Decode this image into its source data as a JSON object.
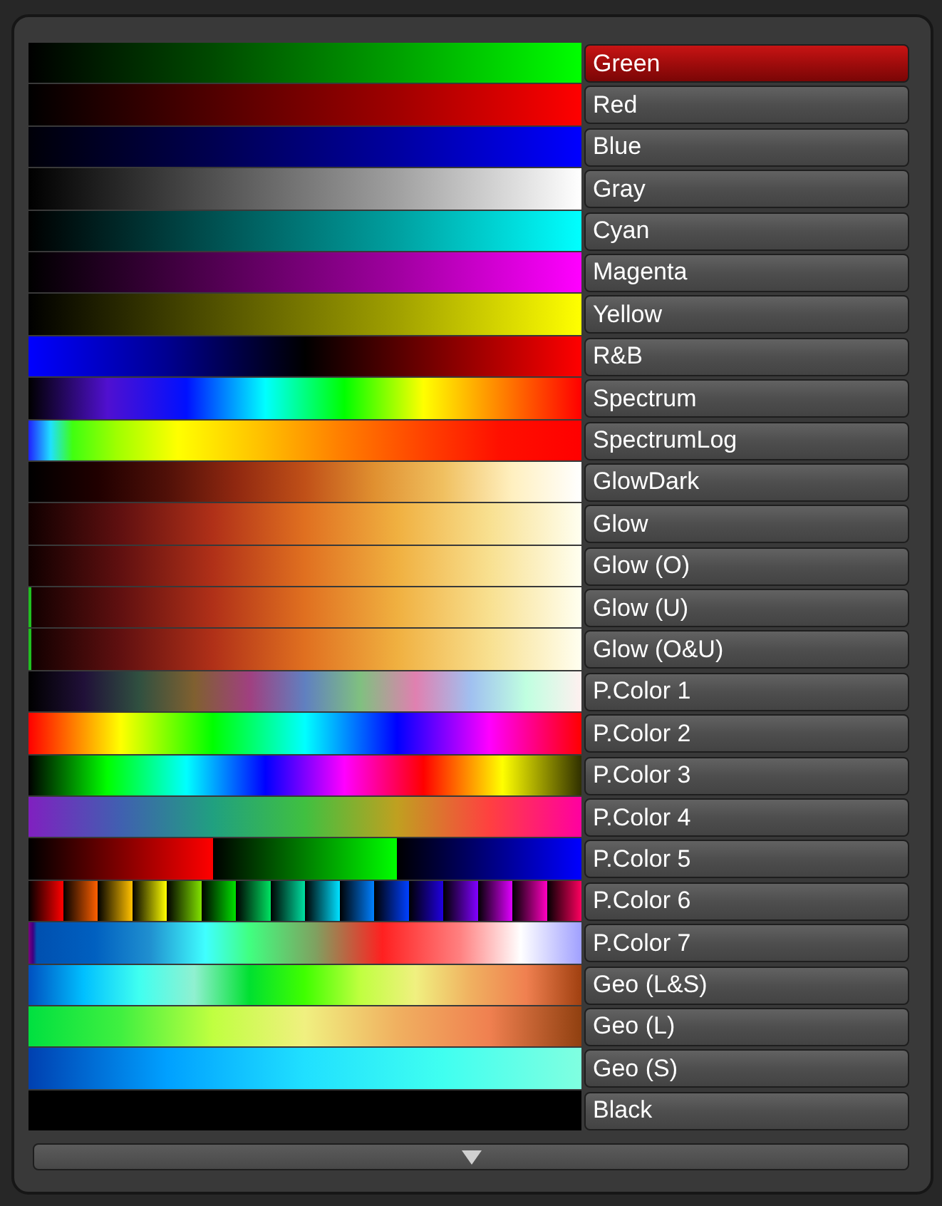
{
  "colormap_menu": {
    "items": [
      {
        "label": "Green",
        "selected": true,
        "kind": "green",
        "underflow": false
      },
      {
        "label": "Red",
        "selected": false,
        "kind": "red",
        "underflow": false
      },
      {
        "label": "Blue",
        "selected": false,
        "kind": "blue",
        "underflow": false
      },
      {
        "label": "Gray",
        "selected": false,
        "kind": "gray",
        "underflow": false
      },
      {
        "label": "Cyan",
        "selected": false,
        "kind": "cyan",
        "underflow": false
      },
      {
        "label": "Magenta",
        "selected": false,
        "kind": "magenta",
        "underflow": false
      },
      {
        "label": "Yellow",
        "selected": false,
        "kind": "yellow",
        "underflow": false
      },
      {
        "label": "R&B",
        "selected": false,
        "kind": "bluered",
        "underflow": false
      },
      {
        "label": "Spectrum",
        "selected": false,
        "kind": "spectrum",
        "underflow": false
      },
      {
        "label": "SpectrumLog",
        "selected": false,
        "kind": "spectrumlog",
        "underflow": false
      },
      {
        "label": "GlowDark",
        "selected": false,
        "kind": "glowdark",
        "underflow": false
      },
      {
        "label": "Glow",
        "selected": false,
        "kind": "glow",
        "underflow": false
      },
      {
        "label": "Glow (O)",
        "selected": false,
        "kind": "glow",
        "underflow": false
      },
      {
        "label": "Glow (U)",
        "selected": false,
        "kind": "glow",
        "underflow": true
      },
      {
        "label": "Glow (O&U)",
        "selected": false,
        "kind": "glow",
        "underflow": true
      },
      {
        "label": "P.Color 1",
        "selected": false,
        "kind": "pastel",
        "underflow": false
      },
      {
        "label": "P.Color 2",
        "selected": false,
        "kind": "hue",
        "underflow": false
      },
      {
        "label": "P.Color 3",
        "selected": false,
        "kind": "darkhue",
        "underflow": false
      },
      {
        "label": "P.Color 4",
        "selected": false,
        "kind": "muted",
        "underflow": false
      },
      {
        "label": "P.Color 5",
        "selected": false,
        "kind": "threeband",
        "underflow": false
      },
      {
        "label": "P.Color 6",
        "selected": false,
        "kind": "steps",
        "underflow": false
      },
      {
        "label": "P.Color 7",
        "selected": false,
        "kind": "rainbowwhite",
        "underflow": false
      },
      {
        "label": "Geo (L&S)",
        "selected": false,
        "kind": "terrain",
        "underflow": false
      },
      {
        "label": "Geo (L)",
        "selected": false,
        "kind": "land",
        "underflow": false
      },
      {
        "label": "Geo (S)",
        "selected": false,
        "kind": "sea",
        "underflow": false
      },
      {
        "label": "Black",
        "selected": false,
        "kind": "black",
        "underflow": false
      }
    ]
  }
}
